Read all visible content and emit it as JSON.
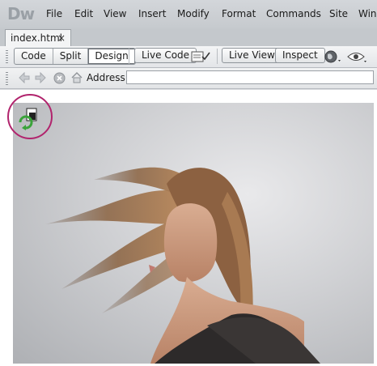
{
  "app": {
    "logo": "Dw",
    "menu": [
      "File",
      "Edit",
      "View",
      "Insert",
      "Modify",
      "Format",
      "Commands",
      "Site",
      "Win"
    ]
  },
  "document": {
    "tab_label": "index.html",
    "close_glyph": "×"
  },
  "toolbar": {
    "view_buttons": [
      "Code",
      "Split",
      "Design"
    ],
    "active_view": "Design",
    "live_code": "Live Code",
    "live_view": "Live View",
    "inspect": "Inspect",
    "icons": [
      "check-page-icon",
      "browser-preview-icon",
      "visual-aids-icon"
    ]
  },
  "navbar": {
    "address_label": "Address:",
    "address_value": "",
    "icons": [
      "back-arrow-icon",
      "forward-arrow-icon",
      "stop-icon",
      "home-icon"
    ]
  },
  "design_view": {
    "image_subject": "woman-hair-flip-photo",
    "sync_indicator": "refresh-sync-icon",
    "highlight_color": "#b1246d"
  }
}
